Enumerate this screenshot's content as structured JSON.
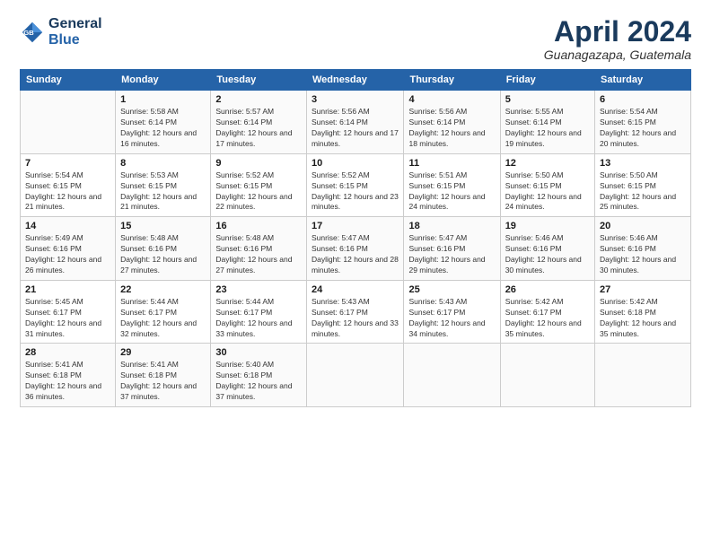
{
  "header": {
    "logo_line1": "General",
    "logo_line2": "Blue",
    "month_title": "April 2024",
    "subtitle": "Guanagazapa, Guatemala"
  },
  "days_of_week": [
    "Sunday",
    "Monday",
    "Tuesday",
    "Wednesday",
    "Thursday",
    "Friday",
    "Saturday"
  ],
  "weeks": [
    [
      {
        "day": "",
        "sunrise": "",
        "sunset": "",
        "daylight": ""
      },
      {
        "day": "1",
        "sunrise": "Sunrise: 5:58 AM",
        "sunset": "Sunset: 6:14 PM",
        "daylight": "Daylight: 12 hours and 16 minutes."
      },
      {
        "day": "2",
        "sunrise": "Sunrise: 5:57 AM",
        "sunset": "Sunset: 6:14 PM",
        "daylight": "Daylight: 12 hours and 17 minutes."
      },
      {
        "day": "3",
        "sunrise": "Sunrise: 5:56 AM",
        "sunset": "Sunset: 6:14 PM",
        "daylight": "Daylight: 12 hours and 17 minutes."
      },
      {
        "day": "4",
        "sunrise": "Sunrise: 5:56 AM",
        "sunset": "Sunset: 6:14 PM",
        "daylight": "Daylight: 12 hours and 18 minutes."
      },
      {
        "day": "5",
        "sunrise": "Sunrise: 5:55 AM",
        "sunset": "Sunset: 6:14 PM",
        "daylight": "Daylight: 12 hours and 19 minutes."
      },
      {
        "day": "6",
        "sunrise": "Sunrise: 5:54 AM",
        "sunset": "Sunset: 6:15 PM",
        "daylight": "Daylight: 12 hours and 20 minutes."
      }
    ],
    [
      {
        "day": "7",
        "sunrise": "Sunrise: 5:54 AM",
        "sunset": "Sunset: 6:15 PM",
        "daylight": "Daylight: 12 hours and 21 minutes."
      },
      {
        "day": "8",
        "sunrise": "Sunrise: 5:53 AM",
        "sunset": "Sunset: 6:15 PM",
        "daylight": "Daylight: 12 hours and 21 minutes."
      },
      {
        "day": "9",
        "sunrise": "Sunrise: 5:52 AM",
        "sunset": "Sunset: 6:15 PM",
        "daylight": "Daylight: 12 hours and 22 minutes."
      },
      {
        "day": "10",
        "sunrise": "Sunrise: 5:52 AM",
        "sunset": "Sunset: 6:15 PM",
        "daylight": "Daylight: 12 hours and 23 minutes."
      },
      {
        "day": "11",
        "sunrise": "Sunrise: 5:51 AM",
        "sunset": "Sunset: 6:15 PM",
        "daylight": "Daylight: 12 hours and 24 minutes."
      },
      {
        "day": "12",
        "sunrise": "Sunrise: 5:50 AM",
        "sunset": "Sunset: 6:15 PM",
        "daylight": "Daylight: 12 hours and 24 minutes."
      },
      {
        "day": "13",
        "sunrise": "Sunrise: 5:50 AM",
        "sunset": "Sunset: 6:15 PM",
        "daylight": "Daylight: 12 hours and 25 minutes."
      }
    ],
    [
      {
        "day": "14",
        "sunrise": "Sunrise: 5:49 AM",
        "sunset": "Sunset: 6:16 PM",
        "daylight": "Daylight: 12 hours and 26 minutes."
      },
      {
        "day": "15",
        "sunrise": "Sunrise: 5:48 AM",
        "sunset": "Sunset: 6:16 PM",
        "daylight": "Daylight: 12 hours and 27 minutes."
      },
      {
        "day": "16",
        "sunrise": "Sunrise: 5:48 AM",
        "sunset": "Sunset: 6:16 PM",
        "daylight": "Daylight: 12 hours and 27 minutes."
      },
      {
        "day": "17",
        "sunrise": "Sunrise: 5:47 AM",
        "sunset": "Sunset: 6:16 PM",
        "daylight": "Daylight: 12 hours and 28 minutes."
      },
      {
        "day": "18",
        "sunrise": "Sunrise: 5:47 AM",
        "sunset": "Sunset: 6:16 PM",
        "daylight": "Daylight: 12 hours and 29 minutes."
      },
      {
        "day": "19",
        "sunrise": "Sunrise: 5:46 AM",
        "sunset": "Sunset: 6:16 PM",
        "daylight": "Daylight: 12 hours and 30 minutes."
      },
      {
        "day": "20",
        "sunrise": "Sunrise: 5:46 AM",
        "sunset": "Sunset: 6:16 PM",
        "daylight": "Daylight: 12 hours and 30 minutes."
      }
    ],
    [
      {
        "day": "21",
        "sunrise": "Sunrise: 5:45 AM",
        "sunset": "Sunset: 6:17 PM",
        "daylight": "Daylight: 12 hours and 31 minutes."
      },
      {
        "day": "22",
        "sunrise": "Sunrise: 5:44 AM",
        "sunset": "Sunset: 6:17 PM",
        "daylight": "Daylight: 12 hours and 32 minutes."
      },
      {
        "day": "23",
        "sunrise": "Sunrise: 5:44 AM",
        "sunset": "Sunset: 6:17 PM",
        "daylight": "Daylight: 12 hours and 33 minutes."
      },
      {
        "day": "24",
        "sunrise": "Sunrise: 5:43 AM",
        "sunset": "Sunset: 6:17 PM",
        "daylight": "Daylight: 12 hours and 33 minutes."
      },
      {
        "day": "25",
        "sunrise": "Sunrise: 5:43 AM",
        "sunset": "Sunset: 6:17 PM",
        "daylight": "Daylight: 12 hours and 34 minutes."
      },
      {
        "day": "26",
        "sunrise": "Sunrise: 5:42 AM",
        "sunset": "Sunset: 6:17 PM",
        "daylight": "Daylight: 12 hours and 35 minutes."
      },
      {
        "day": "27",
        "sunrise": "Sunrise: 5:42 AM",
        "sunset": "Sunset: 6:18 PM",
        "daylight": "Daylight: 12 hours and 35 minutes."
      }
    ],
    [
      {
        "day": "28",
        "sunrise": "Sunrise: 5:41 AM",
        "sunset": "Sunset: 6:18 PM",
        "daylight": "Daylight: 12 hours and 36 minutes."
      },
      {
        "day": "29",
        "sunrise": "Sunrise: 5:41 AM",
        "sunset": "Sunset: 6:18 PM",
        "daylight": "Daylight: 12 hours and 37 minutes."
      },
      {
        "day": "30",
        "sunrise": "Sunrise: 5:40 AM",
        "sunset": "Sunset: 6:18 PM",
        "daylight": "Daylight: 12 hours and 37 minutes."
      },
      {
        "day": "",
        "sunrise": "",
        "sunset": "",
        "daylight": ""
      },
      {
        "day": "",
        "sunrise": "",
        "sunset": "",
        "daylight": ""
      },
      {
        "day": "",
        "sunrise": "",
        "sunset": "",
        "daylight": ""
      },
      {
        "day": "",
        "sunrise": "",
        "sunset": "",
        "daylight": ""
      }
    ]
  ]
}
